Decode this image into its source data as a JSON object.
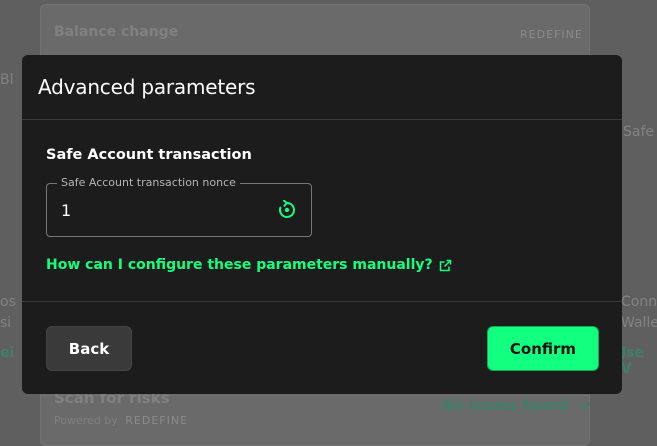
{
  "background": {
    "balance_change_title": "Balance change",
    "redefine_logo_text": "REDEFINE",
    "scan_title": "Scan for risks",
    "powered_by": "Powered by",
    "no_issues": "No issues found",
    "left_edge_text_1": "Bl",
    "left_edge_text_2": "os",
    "left_edge_text_3": "si",
    "left_edge_text_4": "ei",
    "right_edge_text_1": "Safe",
    "right_edge_text_2": "Conn",
    "right_edge_text_3": "Walle",
    "right_edge_text_4": "Jse V"
  },
  "modal": {
    "title": "Advanced parameters",
    "section_title": "Safe Account transaction",
    "nonce_field": {
      "label": "Safe Account transaction nonce",
      "value": "1"
    },
    "help_link": "How can I configure these parameters manually?",
    "back_label": "Back",
    "confirm_label": "Confirm"
  },
  "colors": {
    "accent": "#12ff80",
    "modal_bg": "#1c1c1c",
    "overlay_bg": "#5f5f5f"
  }
}
